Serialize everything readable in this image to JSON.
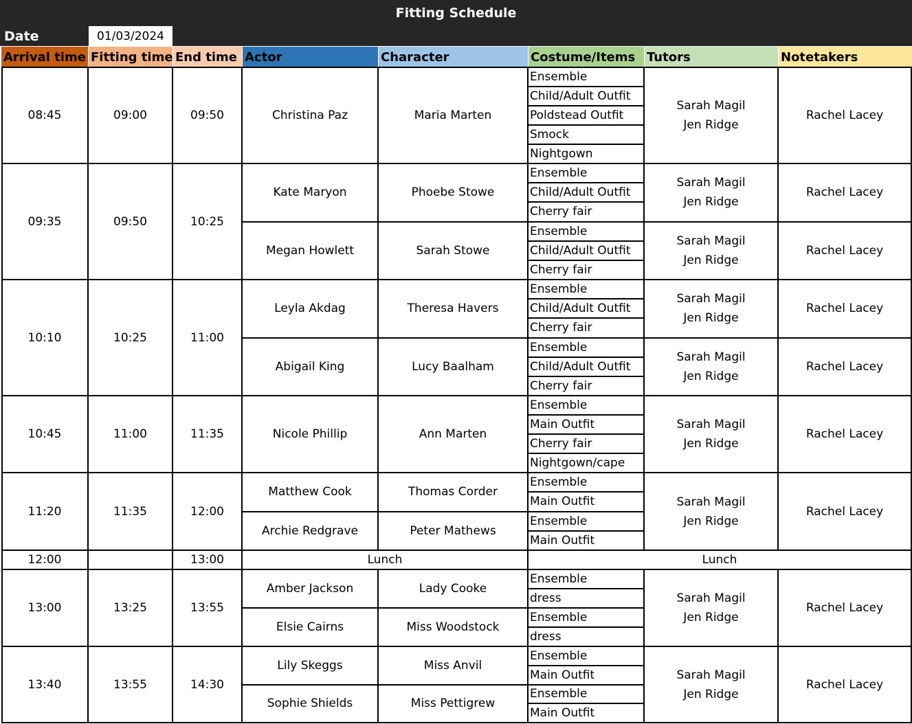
{
  "title": "Fitting Schedule",
  "date_label": "Date",
  "date_value": "01/03/2024",
  "headers": {
    "arrival": "Arrival time",
    "fitting": "Fitting time",
    "end": "End time",
    "actor": "Actor",
    "character": "Character",
    "costume": "Costume/Items",
    "tutors": "Tutors",
    "notetakers": "Notetakers"
  },
  "colors": {
    "title_bar": "#262626",
    "arrival": "#c55a11",
    "fitting": "#f4b183",
    "end": "#f8cbad",
    "actor": "#2e75b6",
    "character": "#9dc3e6",
    "costume": "#a9d18e",
    "tutors": "#c5e0b4",
    "notetakers": "#ffe699"
  },
  "slots": [
    {
      "arrival": "08:45",
      "fitting": "09:00",
      "end": "09:50",
      "actors": [
        {
          "actor": "Christina Paz",
          "character": "Maria Marten",
          "items": [
            "Ensemble",
            "Child/Adult Outfit",
            "Poldstead Outfit",
            "Smock",
            "Nightgown"
          ]
        }
      ],
      "tutors": [
        {
          "lines": [
            "Sarah Magil",
            "Jen Ridge"
          ],
          "notetaker": "Rachel Lacey"
        }
      ]
    },
    {
      "arrival": "09:35",
      "fitting": "09:50",
      "end": "10:25",
      "actors": [
        {
          "actor": "Kate Maryon",
          "character": "Phoebe Stowe",
          "items": [
            "Ensemble",
            "Child/Adult Outfit",
            "Cherry fair"
          ]
        },
        {
          "actor": "Megan Howlett",
          "character": "Sarah Stowe",
          "items": [
            "Ensemble",
            "Child/Adult Outfit",
            "Cherry fair"
          ]
        }
      ],
      "tutors": [
        {
          "lines": [
            "Sarah Magil",
            "Jen Ridge"
          ],
          "notetaker": "Rachel Lacey"
        },
        {
          "lines": [
            "Sarah Magil",
            "Jen Ridge"
          ],
          "notetaker": "Rachel Lacey"
        }
      ]
    },
    {
      "arrival": "10:10",
      "fitting": "10:25",
      "end": "11:00",
      "actors": [
        {
          "actor": "Leyla Akdag",
          "character": "Theresa Havers",
          "items": [
            "Ensemble",
            "Child/Adult Outfit",
            "Cherry fair"
          ]
        },
        {
          "actor": "Abigail King",
          "character": "Lucy Baalham",
          "items": [
            "Ensemble",
            "Child/Adult Outfit",
            "Cherry fair"
          ]
        }
      ],
      "tutors": [
        {
          "lines": [
            "Sarah Magil",
            "Jen Ridge"
          ],
          "notetaker": "Rachel Lacey"
        },
        {
          "lines": [
            "Sarah Magil",
            "Jen Ridge"
          ],
          "notetaker": "Rachel Lacey"
        }
      ]
    },
    {
      "arrival": "10:45",
      "fitting": "11:00",
      "end": "11:35",
      "actors": [
        {
          "actor": "Nicole Phillip",
          "character": "Ann Marten",
          "items": [
            "Ensemble",
            "Main Outfit",
            "Cherry fair",
            "Nightgown/cape"
          ]
        }
      ],
      "tutors": [
        {
          "lines": [
            "Sarah Magil",
            "Jen Ridge"
          ],
          "notetaker": "Rachel Lacey"
        }
      ]
    },
    {
      "arrival": "11:20",
      "fitting": "11:35",
      "end": "12:00",
      "actors": [
        {
          "actor": "Matthew Cook",
          "character": "Thomas Corder",
          "items": [
            "Ensemble",
            "Main Outfit"
          ]
        },
        {
          "actor": "Archie Redgrave",
          "character": "Peter Mathews",
          "items": [
            "Ensemble",
            "Main Outfit"
          ]
        }
      ],
      "tutors": [
        {
          "lines": [
            "Sarah Magil",
            "Jen Ridge"
          ],
          "notetaker": "Rachel Lacey"
        }
      ]
    },
    {
      "lunch": true,
      "arrival": "12:00",
      "fitting": "",
      "end": "13:00",
      "lunch_left": "Lunch",
      "lunch_right": "Lunch"
    },
    {
      "arrival": "13:00",
      "fitting": "13:25",
      "end": "13:55",
      "actors": [
        {
          "actor": "Amber Jackson",
          "character": "Lady Cooke",
          "items": [
            "Ensemble",
            "dress"
          ]
        },
        {
          "actor": "Elsie Cairns",
          "character": "Miss Woodstock",
          "items": [
            "Ensemble",
            "dress"
          ]
        }
      ],
      "tutors": [
        {
          "lines": [
            "Sarah Magil",
            "Jen Ridge"
          ],
          "notetaker": "Rachel Lacey"
        }
      ]
    },
    {
      "arrival": "13:40",
      "fitting": "13:55",
      "end": "14:30",
      "actors": [
        {
          "actor": "Lily Skeggs",
          "character": "Miss  Anvil",
          "items": [
            "Ensemble",
            "Main Outfit"
          ]
        },
        {
          "actor": "Sophie Shields",
          "character": "Miss Pettigrew",
          "items": [
            "Ensemble",
            "Main Outfit"
          ]
        }
      ],
      "tutors": [
        {
          "lines": [
            "Sarah Magil",
            "Jen Ridge"
          ],
          "notetaker": "Rachel Lacey"
        }
      ]
    }
  ]
}
